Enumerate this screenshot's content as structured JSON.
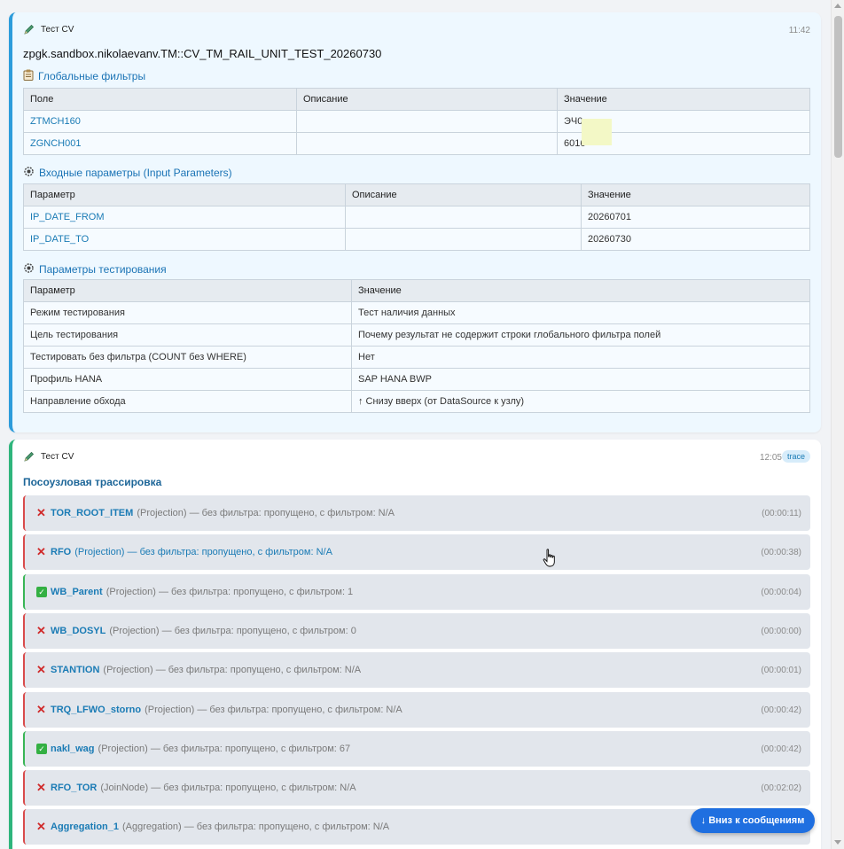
{
  "messages": [
    {
      "author": "Тест CV",
      "time": "11:42",
      "title": "zpgk.sandbox.nikolaevanv.TM::CV_TM_RAIL_UNIT_TEST_20260730",
      "global_filters": {
        "title": "Глобальные фильтры",
        "headers": [
          "Поле",
          "Описание",
          "Значение"
        ],
        "rows": [
          [
            "ZTMCH160",
            "",
            "ЭЧ0"
          ],
          [
            "ZGNCH001",
            "",
            "6016"
          ]
        ]
      },
      "input_params": {
        "title": "Входные параметры (Input Parameters)",
        "headers": [
          "Параметр",
          "Описание",
          "Значение"
        ],
        "rows": [
          [
            "IP_DATE_FROM",
            "",
            "20260701"
          ],
          [
            "IP_DATE_TO",
            "",
            "20260730"
          ]
        ]
      },
      "test_params": {
        "title": "Параметры тестирования",
        "headers": [
          "Параметр",
          "Значение"
        ],
        "rows": [
          [
            "Режим тестирования",
            "Тест наличия данных"
          ],
          [
            "Цель тестирования",
            "Почему результат не содержит строки глобального фильтра полей"
          ],
          [
            "Тестировать без фильтра (COUNT без WHERE)",
            "Нет"
          ],
          [
            "Профиль HANA",
            "SAP HANA BWP"
          ],
          [
            "Направление обхода",
            "↑ Снизу вверх (от DataSource к узлу)"
          ]
        ]
      }
    },
    {
      "author": "Тест CV",
      "time": "12:05",
      "tag": "trace",
      "trace_title": "Посоузловая трассировка",
      "nodes": [
        {
          "status": "err",
          "name": "TOR_ROOT_ITEM",
          "detail": "(Projection) — без фильтра: пропущено, с фильтром: N/A",
          "time": "(00:00:11)",
          "highlight": false
        },
        {
          "status": "err",
          "name": "RFO",
          "detail": "(Projection) — без фильтра: пропущено, с фильтром: N/A",
          "time": "(00:00:38)",
          "highlight": true
        },
        {
          "status": "ok",
          "name": "WB_Parent",
          "detail": "(Projection) — без фильтра: пропущено, с фильтром: 1",
          "time": "(00:00:04)",
          "highlight": false
        },
        {
          "status": "err",
          "name": "WB_DOSYL",
          "detail": "(Projection) — без фильтра: пропущено, с фильтром: 0",
          "time": "(00:00:00)",
          "highlight": false
        },
        {
          "status": "err",
          "name": "STANTION",
          "detail": "(Projection) — без фильтра: пропущено, с фильтром: N/A",
          "time": "(00:00:01)",
          "highlight": false
        },
        {
          "status": "err",
          "name": "TRQ_LFWO_storno",
          "detail": "(Projection) — без фильтра: пропущено, с фильтром: N/A",
          "time": "(00:00:42)",
          "highlight": false
        },
        {
          "status": "ok",
          "name": "nakl_wag",
          "detail": "(Projection) — без фильтра: пропущено, с фильтром: 67",
          "time": "(00:00:42)",
          "highlight": false
        },
        {
          "status": "err",
          "name": "RFO_TOR",
          "detail": "(JoinNode) — без фильтра: пропущено, с фильтром: N/A",
          "time": "(00:02:02)",
          "highlight": false
        },
        {
          "status": "err",
          "name": "Aggregation_1",
          "detail": "(Aggregation) — без фильтра: пропущено, с фильтром: N/A",
          "time": "",
          "highlight": false
        }
      ]
    }
  ],
  "jump_button": "↓ Вниз к сообщениям",
  "icons": {
    "author": "pencil-icon",
    "filters": "clipboard-icon",
    "params": "gear-icon",
    "error": "cross-icon",
    "ok": "check-icon"
  }
}
